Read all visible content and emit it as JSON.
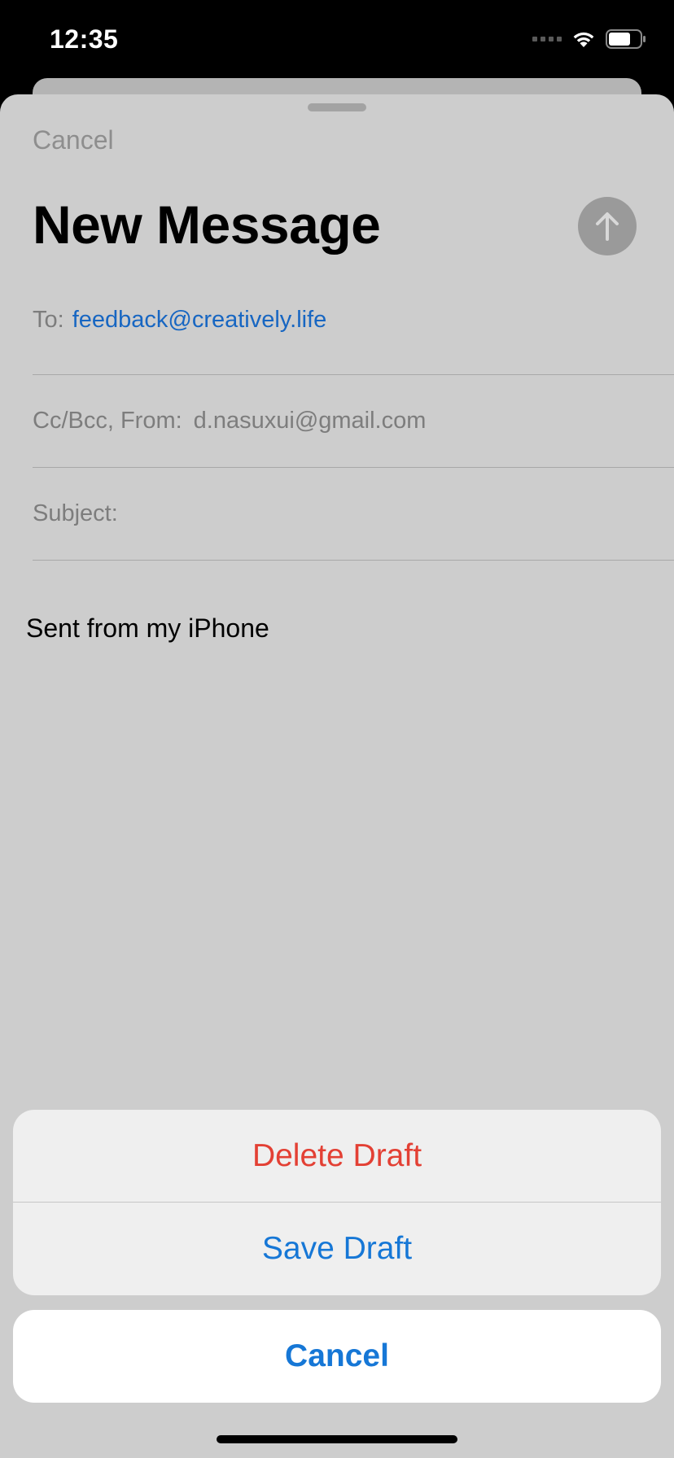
{
  "status_bar": {
    "time": "12:35",
    "icons": [
      "signal-icon",
      "wifi-icon",
      "battery-icon"
    ]
  },
  "compose": {
    "cancel_label": "Cancel",
    "title": "New Message",
    "send_icon": "arrow-up-icon",
    "to_label": "To:",
    "to_value": "feedback@creatively.life",
    "cc_label": "Cc/Bcc, From:",
    "from_value": "d.nasuxui@gmail.com",
    "subject_label": "Subject:",
    "body_signature": "Sent from my iPhone"
  },
  "action_sheet": {
    "delete_label": "Delete Draft",
    "save_label": "Save Draft",
    "cancel_label": "Cancel"
  },
  "colors": {
    "destructive": "#e34034",
    "accent": "#1677d6",
    "link": "#1766c2"
  }
}
